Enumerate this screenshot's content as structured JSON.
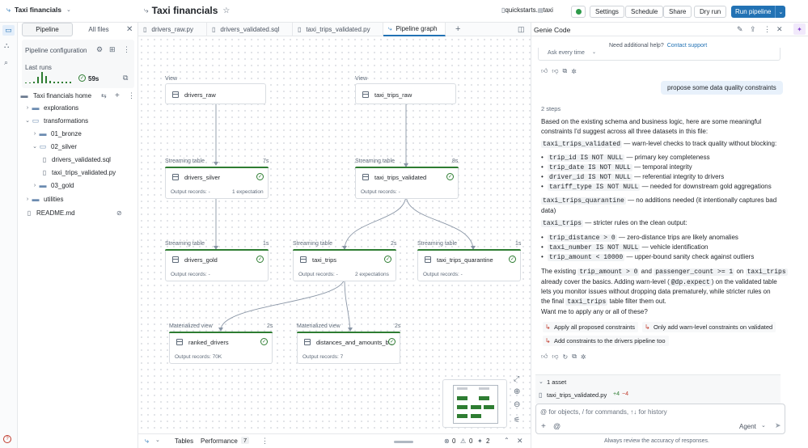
{
  "app": {
    "title": "Taxi financials",
    "page_title": "Taxi financials",
    "breadcrumb_catalog": "quickstarts",
    "breadcrumb_schema": "taxi",
    "buttons": {
      "settings": "Settings",
      "schedule": "Schedule",
      "share": "Share",
      "dry_run": "Dry run",
      "run_pipeline": "Run pipeline"
    },
    "accent": "#2272b4"
  },
  "sidebar": {
    "tabs": [
      "Pipeline",
      "All files"
    ],
    "config_label": "Pipeline configuration",
    "last_runs_label": "Last runs",
    "last_run_duration": "59s",
    "tree": {
      "home": "Taxi financials home",
      "explorations": "explorations",
      "transformations": "transformations",
      "bronze": "01_bronze",
      "silver": "02_silver",
      "file1": "drivers_validated.sql",
      "file2": "taxi_trips_validated.py",
      "gold": "03_gold",
      "utilities": "utilities",
      "readme": "README.md"
    }
  },
  "tabs": [
    "drivers_raw.py",
    "drivers_validated.sql",
    "taxi_trips_validated.py",
    "Pipeline graph"
  ],
  "graph": {
    "nodes": [
      {
        "kind": "View",
        "name": "drivers_raw",
        "time": "",
        "records": "",
        "expect": ""
      },
      {
        "kind": "View",
        "name": "taxi_trips_raw",
        "time": "",
        "records": "",
        "expect": ""
      },
      {
        "kind": "Streaming table",
        "name": "drivers_silver",
        "time": "7s",
        "records": "Output records: -",
        "expect": "1 expectation"
      },
      {
        "kind": "Streaming table",
        "name": "taxi_trips_validated",
        "time": "8s",
        "records": "Output records: -",
        "expect": ""
      },
      {
        "kind": "Streaming table",
        "name": "drivers_gold",
        "time": "1s",
        "records": "Output records: -",
        "expect": ""
      },
      {
        "kind": "Streaming table",
        "name": "taxi_trips",
        "time": "2s",
        "records": "Output records: -",
        "expect": "2 expectations"
      },
      {
        "kind": "Streaming table",
        "name": "taxi_trips_quarantine",
        "time": "1s",
        "records": "Output records: -",
        "expect": ""
      },
      {
        "kind": "Materialized view",
        "name": "ranked_drivers",
        "time": "2s",
        "records": "Output records: 70K",
        "expect": ""
      },
      {
        "kind": "Materialized view",
        "name": "distances_and_amounts_b...",
        "time": "2s",
        "records": "Output records: 7",
        "expect": ""
      }
    ]
  },
  "bottom": {
    "tables": "Tables",
    "performance": "Performance",
    "performance_count": "7",
    "errors": "0",
    "warnings": "0",
    "info": "2"
  },
  "genie": {
    "title": "Genie Code",
    "help_text": "Need additional help?",
    "contact": "Contact support",
    "ask_every_time": "Ask every time",
    "user_message": "propose some data quality constraints",
    "steps": "2 steps",
    "intro": "Based on the existing schema and business logic, here are some meaningful constraints I'd suggest across all three datasets in this file:",
    "s1_code": "taxi_trips_validated",
    "s1_text": "— warn-level checks to track quality without blocking:",
    "s1_items": [
      {
        "code": "trip_id IS NOT NULL",
        "text": "— primary key completeness"
      },
      {
        "code": "trip_date IS NOT NULL",
        "text": "— temporal integrity"
      },
      {
        "code": "driver_id IS NOT NULL",
        "text": "— referential integrity to drivers"
      },
      {
        "code": "tariff_type IS NOT NULL",
        "text": "— needed for downstream gold aggregations"
      }
    ],
    "s2_code": "taxi_trips_quarantine",
    "s2_text": "— no additions needed (it intentionally captures bad",
    "s2_text2": "data)",
    "s3_code": "taxi_trips",
    "s3_text": "— stricter rules on the clean output:",
    "s3_items": [
      {
        "code": "trip_distance > 0",
        "text": "— zero-distance trips are likely anomalies"
      },
      {
        "code": "taxi_number IS NOT NULL",
        "text": "— vehicle identification"
      },
      {
        "code": "trip_amount < 10000",
        "text": "— upper-bound sanity check against outliers"
      }
    ],
    "p1_a": "The existing",
    "p1_code1": "trip_amount > 0",
    "p1_b": "and",
    "p1_code2": "passenger_count >= 1",
    "p1_c": "on",
    "p1_code3": "taxi_trips",
    "p2_a": "already cover the basics. Adding warn-level (",
    "p2_code": "@dp.expect",
    "p2_b": ") on the validated table",
    "p3": "lets you monitor issues without dropping data prematurely, while stricter rules on",
    "p4_a": "the final",
    "p4_code": "taxi_trips",
    "p4_b": "table filter them out.",
    "question": "Want me to apply any or all of these?",
    "suggestions": [
      "Apply all proposed constraints",
      "Only add warn-level constraints on validated",
      "Add constraints to the drivers pipeline too"
    ],
    "assets_label": "1 asset",
    "asset_file": "taxi_trips_validated.py",
    "asset_added": "+4",
    "asset_removed": "−4",
    "input_placeholder": "@ for objects, / for commands, ↑↓ for history",
    "agent_label": "Agent",
    "footer": "Always review the accuracy of responses."
  }
}
